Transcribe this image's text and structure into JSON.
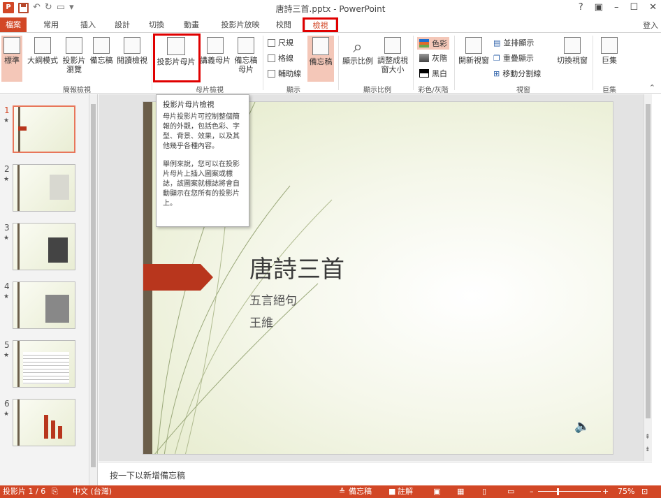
{
  "app": {
    "title": "唐詩三首.pptx - PowerPoint",
    "signin": "登入",
    "window_controls": [
      "?",
      "▣",
      "–",
      "☐",
      "✕"
    ]
  },
  "tabs": [
    {
      "label": "檔案"
    },
    {
      "label": "常用"
    },
    {
      "label": "插入"
    },
    {
      "label": "設計"
    },
    {
      "label": "切換"
    },
    {
      "label": "動畫"
    },
    {
      "label": "投影片放映"
    },
    {
      "label": "校閱"
    },
    {
      "label": "檢視"
    }
  ],
  "ribbon": {
    "presentation_views": {
      "group": "簡報檢視",
      "normal": "標準",
      "outline": "大綱模式",
      "sorter": "投影片瀏覽",
      "notes_page": "備忘稿",
      "reading": "閱讀檢視"
    },
    "master_views": {
      "group": "母片檢視",
      "slide_master": "投影片母片",
      "handout_master": "講義母片",
      "notes_master": "備忘稿母片"
    },
    "show": {
      "group": "顯示",
      "ruler": "尺規",
      "gridlines": "格線",
      "guides": "輔助線",
      "notes": "備忘稿"
    },
    "zoom": {
      "group": "顯示比例",
      "zoom": "顯示比例",
      "fit": "調整成視窗大小"
    },
    "color": {
      "group": "彩色/灰階",
      "color": "色彩",
      "grayscale": "灰階",
      "bw": "黑白"
    },
    "window": {
      "group": "視窗",
      "new_window": "開新視窗",
      "arrange_all": "並排顯示",
      "cascade": "重疊顯示",
      "move_split": "移動分割線",
      "switch": "切換視窗"
    },
    "macros": {
      "group": "巨集",
      "macros": "巨集"
    }
  },
  "tooltip": {
    "title": "投影片母片檢視",
    "para1": "母片投影片可控制整個簡報的外觀，包括色彩、字型、背景、效果，以及其他幾乎各種內容。",
    "para2": "舉例來說，您可以在投影片母片上插入圖案或標誌，該圖案就標誌將會自動顯示在您所有的投影片上。"
  },
  "slides": [
    {
      "num": "1",
      "star": "★"
    },
    {
      "num": "2",
      "star": "★"
    },
    {
      "num": "3",
      "star": "★"
    },
    {
      "num": "4",
      "star": "★"
    },
    {
      "num": "5",
      "star": "★"
    },
    {
      "num": "6",
      "star": "★"
    }
  ],
  "slide": {
    "title": "唐詩三首",
    "subtitle1": "五言絕句",
    "subtitle2": "王維"
  },
  "notes": {
    "placeholder": "按一下以新增備忘稿"
  },
  "status": {
    "slide_info": "投影片 1 / 6",
    "language": "中文 (台灣)",
    "notes_btn": "備忘稿",
    "comments_btn": "註解",
    "zoom": "75%"
  },
  "colors": {
    "accent": "#d24726",
    "highlight": "#e00000"
  }
}
